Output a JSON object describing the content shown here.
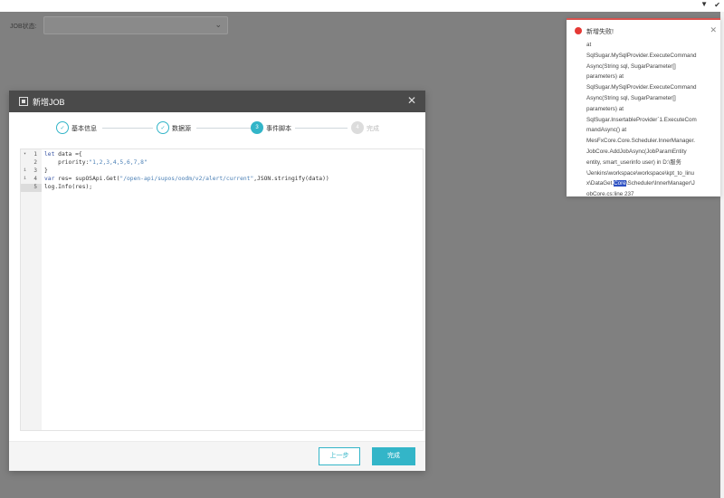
{
  "filter": {
    "label": "JOB状态:"
  },
  "modal": {
    "title": "新增JOB",
    "steps": [
      {
        "label": "基本信息",
        "state": "done",
        "marker": "✓"
      },
      {
        "label": "数据源",
        "state": "done",
        "marker": "✓"
      },
      {
        "label": "事件脚本",
        "state": "active",
        "marker": "3"
      },
      {
        "label": "完成",
        "state": "pending",
        "marker": "4"
      }
    ],
    "editor": {
      "lines": [
        {
          "num": "1",
          "fold": "▾"
        },
        {
          "num": "2",
          "fold": ""
        },
        {
          "num": "3",
          "fold": "i"
        },
        {
          "num": "4",
          "fold": "i"
        },
        {
          "num": "5",
          "fold": ""
        }
      ],
      "code": {
        "l1_kw": "let",
        "l1_rest": " data ={",
        "l2_key": "    priority:",
        "l2_str": "\"1,2,3,4,5,6,7,8\"",
        "l3": "}",
        "l4_kw": "var",
        "l4_a": " res= supOSApi.Get(",
        "l4_str": "\"/open-api/supos/oodm/v2/alert/current\"",
        "l4_b": ",JSON.stringify(data))",
        "l5": "log.Info(res);"
      }
    },
    "buttons": {
      "prev": "上一步",
      "finish": "完成"
    }
  },
  "notification": {
    "title": "新增失败!",
    "lines": [
      "at",
      "SqlSugar.MySqlProvider.ExecuteCommand",
      "Async(String sql, SugarParameter[]",
      "parameters) at",
      "SqlSugar.MySqlProvider.ExecuteCommand",
      "Async(String sql, SugarParameter[]",
      "parameters) at",
      "SqlSugar.InsertableProvider`1.ExecuteCom",
      "mandAsync() at",
      "MesFxCore.Core.Scheduler.InnerManager.",
      "JobCore.AddJobAsync(JobParamEntity",
      "entity, smart_userinfo user) in D:\\服务",
      "\\Jenkins\\workspace\\workspace\\kpt_to_linu"
    ],
    "line14_pre": "x\\DataGet.",
    "line14_sel": "Core",
    "line14_post": "\\Scheduler\\InnerManager\\J",
    "line15": "obCore.cs:line 237"
  },
  "icons": {
    "error": "error-dot-icon",
    "close": "close-icon",
    "chevron": "chevron-down-icon",
    "check": "check-icon"
  },
  "colors": {
    "accent": "#33b5c8",
    "error": "#e53935",
    "header": "#4a4a4a",
    "backdrop": "#808080"
  }
}
